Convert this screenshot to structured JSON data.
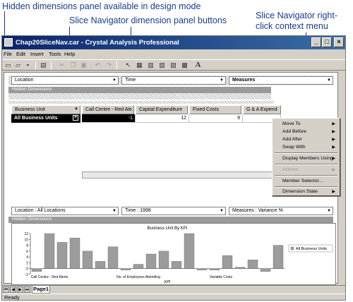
{
  "callouts": {
    "hidden_dims": "Hidden dimensions panel available in design mode",
    "dim_buttons": "Slice Navigator dimension panel buttons",
    "context_menu_line1": "Slice Navigator right-",
    "context_menu_line2": "click context menu"
  },
  "window": {
    "title": "Chap20SliceNav.car - Crystal Analysis Professional",
    "controls": {
      "minimize": "_",
      "maximize": "□",
      "close": "×"
    }
  },
  "menubar": [
    "File",
    "Edit",
    "Insert",
    "Tools",
    "Help"
  ],
  "toolbar_icons": [
    "new-icon",
    "open-icon",
    "save-icon",
    "print-icon",
    "cut-icon",
    "copy-icon",
    "paste-icon",
    "undo-icon",
    "redo-icon",
    "pointer-icon",
    "grid-icon",
    "chart-icon",
    "slice-icon",
    "table-icon",
    "graph-icon",
    "text-icon"
  ],
  "dimension_panel": {
    "location": "Location",
    "time": "Time",
    "measures": "Measures"
  },
  "hidden_dimensions_label": "Hidden Dimensions",
  "grid": {
    "row_header": "Business Unit",
    "row_label": "All Business Units",
    "columns": [
      "Call Centre - Red Ale...",
      "Capital Expenditure",
      "Fixed Costs",
      "G & A Expend"
    ],
    "values": [
      "-1",
      "12",
      "9",
      ""
    ]
  },
  "slice_bar": {
    "location": "Location : All Locations",
    "time": "Time : 1998",
    "measures": "Measures : Variance %"
  },
  "context_menu": {
    "items": [
      {
        "label": "Move To",
        "submenu": true,
        "enabled": true
      },
      {
        "label": "Add Before",
        "submenu": true,
        "enabled": true
      },
      {
        "label": "Add After",
        "submenu": true,
        "enabled": true
      },
      {
        "label": "Swap With",
        "submenu": true,
        "enabled": true
      },
      {
        "label": "Display Members Using",
        "submenu": true,
        "enabled": true
      },
      {
        "label": "Actions",
        "submenu": true,
        "enabled": false
      },
      {
        "label": "Member Selector...",
        "submenu": false,
        "enabled": true
      },
      {
        "label": "Dimension State",
        "submenu": true,
        "enabled": true
      }
    ]
  },
  "chart_data": {
    "type": "bar",
    "title": "Business Unit By KPI",
    "xlabel": "KPI",
    "ylabel": "",
    "ylim": [
      -2,
      12
    ],
    "yticks": [
      -2,
      0,
      2,
      4,
      6,
      8,
      10,
      12
    ],
    "x_tick_labels": [
      "Call Centre - Red Alerts",
      "No. of Employees Attending",
      "Variable Costs"
    ],
    "series": [
      {
        "name": "All Business Units",
        "values": [
          -1,
          12,
          9,
          10.5,
          6,
          2.5,
          7.5,
          -0.5,
          1.5,
          5,
          6,
          2.5,
          12,
          -0.5,
          -0.5,
          4.5,
          0.5,
          3,
          -1,
          8
        ]
      }
    ],
    "legend": "right",
    "grid": false
  },
  "sheet_tab": "Page1",
  "status": "Ready",
  "colors": {
    "titlebar": "#0a246a",
    "bar": "#9c9c9c",
    "callout": "#1a3a8c"
  }
}
